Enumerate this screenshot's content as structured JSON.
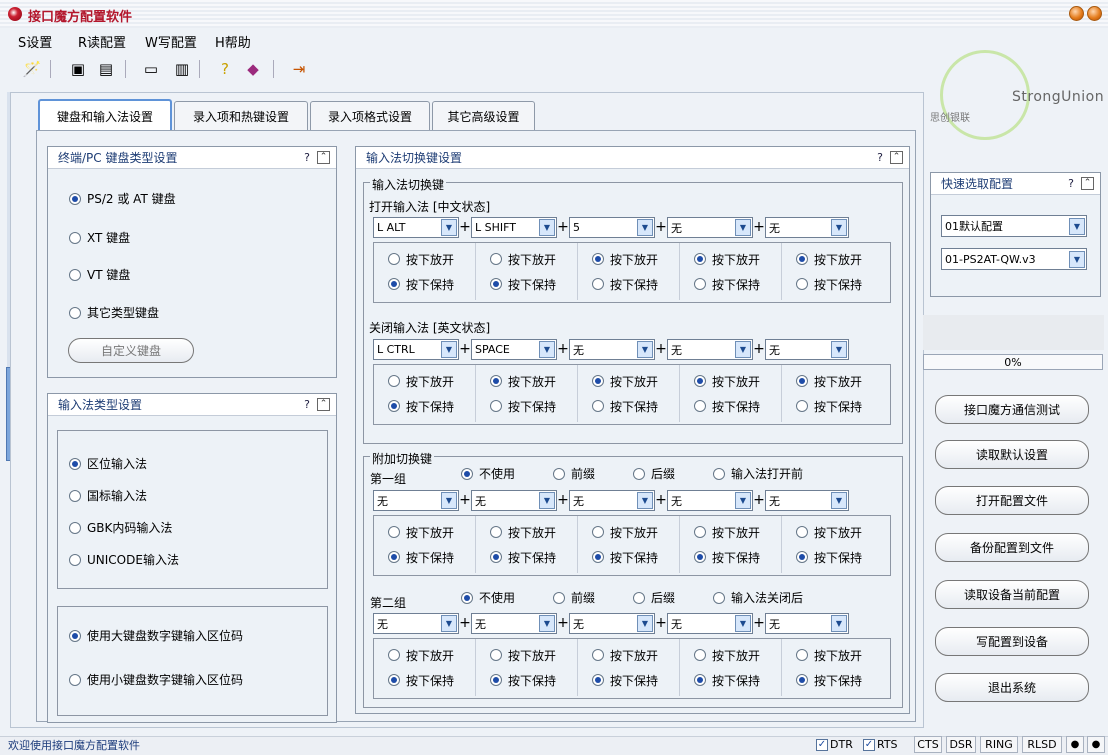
{
  "window": {
    "title": "接口魔方配置软件"
  },
  "menu": [
    "S设置",
    "R读配置",
    "W写配置",
    "H帮助"
  ],
  "logo": {
    "brand": "StrongUnion",
    "subtitle": "思创银联"
  },
  "tabs": [
    "键盘和输入法设置",
    "录入项和热键设置",
    "录入项格式设置",
    "其它高级设置"
  ],
  "keyboard": {
    "title": "终端/PC 键盘类型设置",
    "options": [
      {
        "label": "PS/2 或 AT 键盘",
        "checked": true
      },
      {
        "label": "XT 键盘",
        "checked": false
      },
      {
        "label": "VT 键盘",
        "checked": false
      },
      {
        "label": "其它类型键盘",
        "checked": false
      }
    ],
    "custom_button": "自定义键盘"
  },
  "ime_type": {
    "title": "输入法类型设置",
    "options": [
      {
        "label": "区位输入法",
        "checked": true
      },
      {
        "label": "国标输入法",
        "checked": false
      },
      {
        "label": "GBK内码输入法",
        "checked": false
      },
      {
        "label": "UNICODE输入法",
        "checked": false
      }
    ],
    "numpad_options": [
      {
        "label": "使用大键盘数字键输入区位码",
        "checked": true
      },
      {
        "label": "使用小键盘数字键输入区位码",
        "checked": false
      }
    ]
  },
  "switch": {
    "title": "输入法切换键设置",
    "group_label": "输入法切换键",
    "open_label": "打开输入法 [中文状态]",
    "close_label": "关闭输入法 [英文状态]",
    "open_keys": [
      "L ALT",
      "L SHIFT",
      "5",
      "无",
      "无"
    ],
    "close_keys": [
      "L CTRL",
      "SPACE",
      "无",
      "无",
      "无"
    ],
    "radio_labels": [
      "按下放开",
      "按下保持"
    ],
    "open_radios": [
      1,
      1,
      0,
      0,
      0
    ],
    "close_radios": [
      1,
      0,
      0,
      0,
      0
    ],
    "extra_label": "附加切换键",
    "first_group": "第一组",
    "second_group": "第二组",
    "first_opts": [
      "不使用",
      "前缀",
      "后缀",
      "输入法打开前"
    ],
    "second_opts": [
      "不使用",
      "前缀",
      "后缀",
      "输入法关闭后"
    ],
    "first_keys": [
      "无",
      "无",
      "无",
      "无",
      "无"
    ],
    "second_keys": [
      "无",
      "无",
      "无",
      "无",
      "无"
    ],
    "first_radios": [
      1,
      1,
      1,
      1,
      1
    ],
    "second_radios": [
      1,
      1,
      1,
      1,
      1
    ]
  },
  "quick": {
    "title": "快速选取配置",
    "select1": "01默认配置",
    "select2": "01-PS2AT-QW.v3",
    "progress": "0%"
  },
  "actions": [
    "接口魔方通信测试",
    "读取默认设置",
    "打开配置文件",
    "备份配置到文件",
    "读取设备当前配置",
    "写配置到设备",
    "退出系统"
  ],
  "status": {
    "message": "欢迎使用接口魔方配置软件",
    "dtr": "DTR",
    "rts": "RTS",
    "cts": "CTS",
    "dsr": "DSR",
    "ring": "RING",
    "rlsd": "RLSD"
  }
}
